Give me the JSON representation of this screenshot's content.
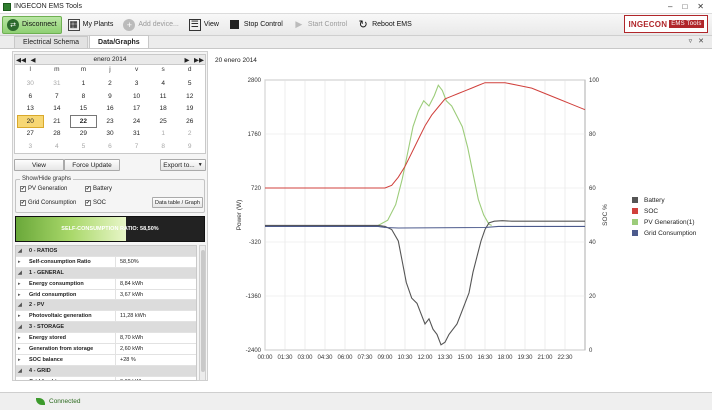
{
  "window": {
    "title": "INGECON EMS Tools",
    "controls": [
      "–",
      "□",
      "✕"
    ]
  },
  "toolbar": {
    "buttons": [
      {
        "label": "Disconnect",
        "icon": "disconnect-icon",
        "enabled": true,
        "selected": true
      },
      {
        "label": "My Plants",
        "icon": "plants-icon",
        "enabled": true
      },
      {
        "label": "Add device...",
        "icon": "add-icon",
        "enabled": false
      },
      {
        "label": "View",
        "icon": "view-icon",
        "enabled": true
      },
      {
        "label": "Stop Control",
        "icon": "stop-icon",
        "enabled": true
      },
      {
        "label": "Start Control",
        "icon": "play-icon",
        "enabled": false
      },
      {
        "label": "Reboot EMS",
        "icon": "reboot-icon",
        "enabled": true
      }
    ],
    "brand": "INGECON",
    "brand_sub": "EMS Tools"
  },
  "tabs": [
    {
      "label": "Electrical Schema",
      "active": false
    },
    {
      "label": "Data/Graphs",
      "active": true
    }
  ],
  "calendar": {
    "month_label": "enero 2014",
    "nav": [
      "◀◀",
      "◀",
      "▶",
      "▶▶"
    ],
    "weekdays": [
      "l",
      "m",
      "m",
      "j",
      "v",
      "s",
      "d"
    ],
    "weeks": [
      [
        "30",
        "31",
        "1",
        "2",
        "3",
        "4",
        "5"
      ],
      [
        "6",
        "7",
        "8",
        "9",
        "10",
        "11",
        "12"
      ],
      [
        "13",
        "14",
        "15",
        "16",
        "17",
        "18",
        "19"
      ],
      [
        "20",
        "21",
        "22",
        "23",
        "24",
        "25",
        "26"
      ],
      [
        "27",
        "28",
        "29",
        "30",
        "31",
        "1",
        "2"
      ],
      [
        "3",
        "4",
        "5",
        "6",
        "7",
        "8",
        "9"
      ]
    ],
    "selected_day": "20",
    "today_day": "22"
  },
  "actions": {
    "view": "View",
    "force_update": "Force Update",
    "export": "Export to..."
  },
  "show_hide": {
    "legend": "Show/Hide graphs",
    "items": [
      {
        "label": "PV Generation",
        "checked": true
      },
      {
        "label": "Battery",
        "checked": true
      },
      {
        "label": "Grid Consumption",
        "checked": true
      },
      {
        "label": "SOC",
        "checked": true
      }
    ],
    "data_table_btn": "Data table / Graph"
  },
  "self_consumption": {
    "label": "SELF-CONSUMPTION RATIO: 58,50%",
    "ratio": 0.585
  },
  "properties": [
    {
      "type": "cat",
      "label": "0 - RATIOS"
    },
    {
      "type": "row",
      "label": "Self-consumption Ratio",
      "value": "58,50%"
    },
    {
      "type": "cat",
      "label": "1 - GENERAL"
    },
    {
      "type": "row",
      "label": "Energy consumption",
      "value": "8,84 kWh"
    },
    {
      "type": "row",
      "label": "Grid consumption",
      "value": "3,67 kWh"
    },
    {
      "type": "cat",
      "label": "2 - PV"
    },
    {
      "type": "row",
      "label": "Photovoltaic generation",
      "value": "11,28 kWh"
    },
    {
      "type": "cat",
      "label": "3 - STORAGE"
    },
    {
      "type": "row",
      "label": "Energy stored",
      "value": "8,70 kWh"
    },
    {
      "type": "row",
      "label": "Generation from storage",
      "value": "2,60 kWh"
    },
    {
      "type": "row",
      "label": "SOC balance",
      "value": "+28 %"
    },
    {
      "type": "cat",
      "label": "4 - GRID"
    },
    {
      "type": "row",
      "label": "Grid feed-in",
      "value": "0,00 kWh"
    }
  ],
  "status": {
    "text": "Connected"
  },
  "chart_data": {
    "type": "line",
    "title": "20 enero 2014",
    "ylabel": "Power (W)",
    "y2label": "SOC %",
    "ylim": [
      -2400,
      2800
    ],
    "y2lim": [
      0,
      100
    ],
    "yticks": [
      2800,
      1760,
      720,
      -320,
      -1360,
      -2400
    ],
    "y2ticks": [
      100,
      80,
      60,
      40,
      20,
      0
    ],
    "xticks": [
      "00:00",
      "01:30",
      "03:00",
      "04:30",
      "06:00",
      "07:30",
      "09:00",
      "10:30",
      "12:00",
      "13:30",
      "15:00",
      "16:30",
      "18:00",
      "19:30",
      "21:00",
      "22:30"
    ],
    "xrange": [
      0,
      24
    ],
    "grid": true,
    "legend_position": "right",
    "series": [
      {
        "name": "Battery",
        "color": "#555555",
        "axis": "left",
        "points": [
          [
            0,
            0
          ],
          [
            8.5,
            0
          ],
          [
            9.0,
            -20
          ],
          [
            9.5,
            -80
          ],
          [
            10.0,
            -300
          ],
          [
            10.3,
            -700
          ],
          [
            10.6,
            -1100
          ],
          [
            11.0,
            -1400
          ],
          [
            11.4,
            -1500
          ],
          [
            11.7,
            -1700
          ],
          [
            12.0,
            -1900
          ],
          [
            12.3,
            -1800
          ],
          [
            12.6,
            -2000
          ],
          [
            12.9,
            -2100
          ],
          [
            13.2,
            -2300
          ],
          [
            13.5,
            -2250
          ],
          [
            13.8,
            -2100
          ],
          [
            14.1,
            -2000
          ],
          [
            14.4,
            -1900
          ],
          [
            14.7,
            -1700
          ],
          [
            15.0,
            -1500
          ],
          [
            15.3,
            -1300
          ],
          [
            15.6,
            -900
          ],
          [
            15.9,
            -600
          ],
          [
            16.2,
            -300
          ],
          [
            16.5,
            -80
          ],
          [
            16.8,
            50
          ],
          [
            17.2,
            80
          ],
          [
            17.8,
            90
          ],
          [
            18.5,
            80
          ],
          [
            24,
            80
          ]
        ]
      },
      {
        "name": "SOC",
        "color": "#d0403c",
        "axis": "right",
        "points": [
          [
            0,
            60
          ],
          [
            9.0,
            60
          ],
          [
            9.5,
            61
          ],
          [
            10.0,
            64
          ],
          [
            10.5,
            68
          ],
          [
            11.0,
            73
          ],
          [
            11.5,
            78
          ],
          [
            12.0,
            83
          ],
          [
            12.5,
            87
          ],
          [
            13.0,
            90
          ],
          [
            13.5,
            93
          ],
          [
            14.0,
            94
          ],
          [
            14.5,
            95
          ],
          [
            15.0,
            96
          ],
          [
            15.5,
            97
          ],
          [
            16.0,
            98
          ],
          [
            16.5,
            99
          ],
          [
            17.0,
            99
          ],
          [
            18.0,
            99
          ],
          [
            19.0,
            98
          ],
          [
            20.0,
            97
          ],
          [
            21.0,
            95
          ],
          [
            22.0,
            93
          ],
          [
            23.0,
            91
          ],
          [
            24,
            89
          ]
        ]
      },
      {
        "name": "PV Generation(1)",
        "color": "#9ccc7a",
        "axis": "left",
        "points": [
          [
            8.5,
            0
          ],
          [
            9.2,
            100
          ],
          [
            9.8,
            400
          ],
          [
            10.3,
            900
          ],
          [
            10.7,
            1400
          ],
          [
            11.1,
            1900
          ],
          [
            11.5,
            2200
          ],
          [
            11.9,
            2400
          ],
          [
            12.3,
            2300
          ],
          [
            12.7,
            2500
          ],
          [
            13.0,
            2700
          ],
          [
            13.3,
            2600
          ],
          [
            13.6,
            2400
          ],
          [
            14.0,
            2300
          ],
          [
            14.4,
            2100
          ],
          [
            14.8,
            1900
          ],
          [
            15.2,
            1500
          ],
          [
            15.6,
            1000
          ],
          [
            16.0,
            500
          ],
          [
            16.4,
            200
          ],
          [
            16.8,
            20
          ],
          [
            17.0,
            0
          ]
        ]
      },
      {
        "name": "Grid Consumption",
        "color": "#4c5a8c",
        "axis": "left",
        "points": [
          [
            0,
            -20
          ],
          [
            8.5,
            -20
          ],
          [
            9.0,
            -40
          ],
          [
            10.0,
            -50
          ],
          [
            16.5,
            -40
          ],
          [
            17.5,
            -20
          ],
          [
            24,
            -20
          ]
        ]
      }
    ]
  }
}
